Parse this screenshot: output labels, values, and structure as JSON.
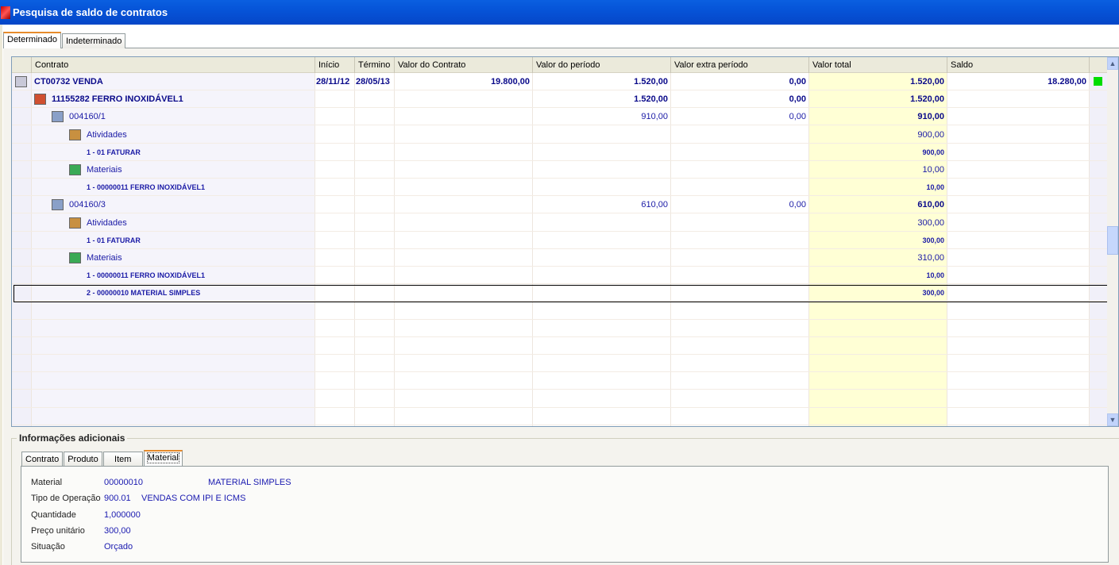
{
  "window": {
    "title": "Pesquisa de saldo de contratos"
  },
  "tabs": [
    {
      "label": "Determinado",
      "active": true
    },
    {
      "label": "Indeterminado",
      "active": false
    }
  ],
  "columns": [
    "Contrato",
    "Início",
    "Término",
    "Valor do Contrato",
    "Valor do período",
    "Valor extra período",
    "Valor total",
    "Saldo"
  ],
  "colors": {
    "valor_total_bg": "#ffffd5",
    "status_green": "#00dd00",
    "text_blue": "#1a1aa6"
  },
  "rows": [
    {
      "level": 0,
      "icon": "contract-person-icon",
      "label": "CT00732  VENDA",
      "inicio": "28/11/12",
      "termino": "28/05/13",
      "valor_contrato": "19.800,00",
      "valor_periodo": "1.520,00",
      "valor_extra": "0,00",
      "valor_total": "1.520,00",
      "saldo": "18.280,00",
      "status": "green",
      "style": "bold"
    },
    {
      "level": 1,
      "icon": "product-box-icon",
      "label": "11155282  FERRO INOXIDÁVEL1",
      "valor_periodo": "1.520,00",
      "valor_extra": "0,00",
      "valor_total": "1.520,00",
      "style": "bold"
    },
    {
      "level": 2,
      "icon": "list-document-icon",
      "label": "004160/1",
      "valor_periodo": "910,00",
      "valor_extra": "0,00",
      "valor_total": "910,00",
      "style": "normal-bold-total"
    },
    {
      "level": 3,
      "icon": "activity-edit-icon",
      "label": "Atividades",
      "valor_total": "900,00",
      "style": "normal"
    },
    {
      "level": 3,
      "label": "1 - 01 FATURAR",
      "valor_total": "900,00",
      "style": "small"
    },
    {
      "level": 3,
      "icon": "shopping-cart-icon",
      "label": "Materiais",
      "valor_total": "10,00",
      "style": "normal"
    },
    {
      "level": 3,
      "label": "1 - 00000011 FERRO INOXIDÁVEL1",
      "valor_total": "10,00",
      "style": "small"
    },
    {
      "level": 2,
      "icon": "list-document-icon",
      "label": "004160/3",
      "valor_periodo": "610,00",
      "valor_extra": "0,00",
      "valor_total": "610,00",
      "style": "normal-bold-total"
    },
    {
      "level": 3,
      "icon": "activity-edit-icon",
      "label": "Atividades",
      "valor_total": "300,00",
      "style": "normal"
    },
    {
      "level": 3,
      "label": "1 - 01 FATURAR",
      "valor_total": "300,00",
      "style": "small"
    },
    {
      "level": 3,
      "icon": "shopping-cart-icon",
      "label": "Materiais",
      "valor_total": "310,00",
      "style": "normal"
    },
    {
      "level": 3,
      "label": "1 - 00000011 FERRO INOXIDÁVEL1",
      "valor_total": "10,00",
      "style": "small"
    },
    {
      "level": 3,
      "label": "2 - 00000010 MATERIAL SIMPLES",
      "valor_total": "300,00",
      "style": "small",
      "selected": true
    }
  ],
  "info": {
    "title": "Informações adicionais",
    "tabs": [
      {
        "label": "Contrato"
      },
      {
        "label": "Produto"
      },
      {
        "label": "Item"
      },
      {
        "label": "Material",
        "active": true
      }
    ],
    "fields": [
      {
        "label": "Material",
        "v1": "00000010",
        "v2": "MATERIAL SIMPLES"
      },
      {
        "label": "Tipo de Operação",
        "v1": "900.01",
        "v2": "VENDAS COM IPI E ICMS"
      },
      {
        "label": "Quantidade",
        "v1": "1,000000"
      },
      {
        "label": "Preço unitário",
        "v1": "300,00"
      },
      {
        "label": "Situação",
        "v1": "Orçado"
      }
    ]
  }
}
